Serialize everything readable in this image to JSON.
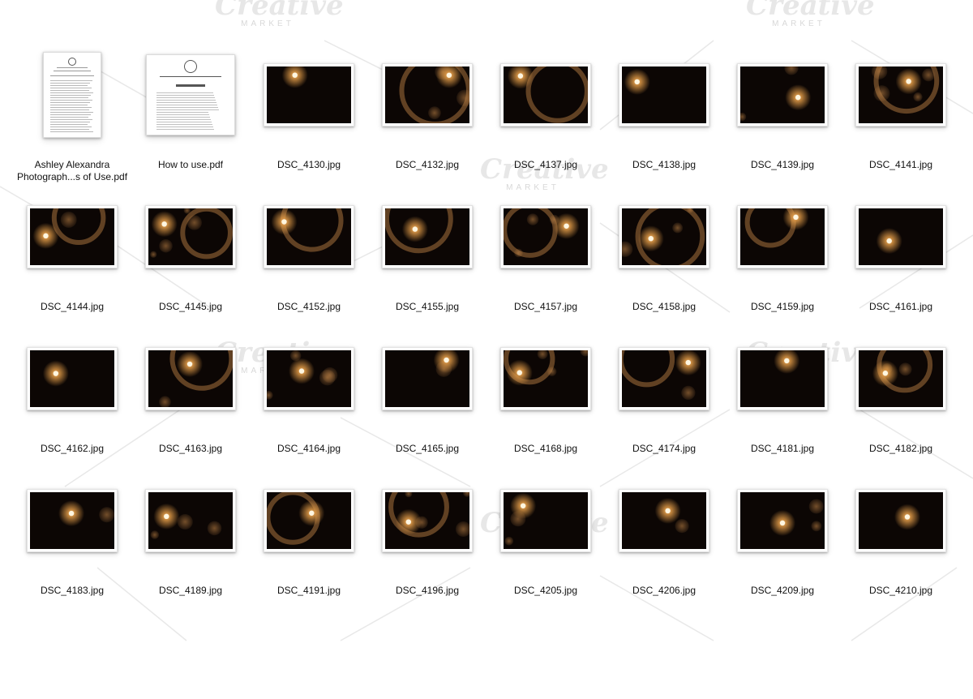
{
  "files": [
    {
      "name": "Ashley Alexandra Photograph...s of Use.pdf",
      "kind": "pdf-terms"
    },
    {
      "name": "How to use.pdf",
      "kind": "pdf-howto"
    },
    {
      "name": "DSC_4130.jpg",
      "kind": "photo"
    },
    {
      "name": "DSC_4132.jpg",
      "kind": "photo"
    },
    {
      "name": "DSC_4137.jpg",
      "kind": "photo"
    },
    {
      "name": "DSC_4138.jpg",
      "kind": "photo"
    },
    {
      "name": "DSC_4139.jpg",
      "kind": "photo"
    },
    {
      "name": "DSC_4141.jpg",
      "kind": "photo"
    },
    {
      "name": "DSC_4144.jpg",
      "kind": "photo"
    },
    {
      "name": "DSC_4145.jpg",
      "kind": "photo"
    },
    {
      "name": "DSC_4152.jpg",
      "kind": "photo"
    },
    {
      "name": "DSC_4155.jpg",
      "kind": "photo"
    },
    {
      "name": "DSC_4157.jpg",
      "kind": "photo"
    },
    {
      "name": "DSC_4158.jpg",
      "kind": "photo"
    },
    {
      "name": "DSC_4159.jpg",
      "kind": "photo"
    },
    {
      "name": "DSC_4161.jpg",
      "kind": "photo"
    },
    {
      "name": "DSC_4162.jpg",
      "kind": "photo"
    },
    {
      "name": "DSC_4163.jpg",
      "kind": "photo"
    },
    {
      "name": "DSC_4164.jpg",
      "kind": "photo"
    },
    {
      "name": "DSC_4165.jpg",
      "kind": "photo"
    },
    {
      "name": "DSC_4168.jpg",
      "kind": "photo"
    },
    {
      "name": "DSC_4174.jpg",
      "kind": "photo"
    },
    {
      "name": "DSC_4181.jpg",
      "kind": "photo"
    },
    {
      "name": "DSC_4182.jpg",
      "kind": "photo"
    },
    {
      "name": "DSC_4183.jpg",
      "kind": "photo"
    },
    {
      "name": "DSC_4189.jpg",
      "kind": "photo"
    },
    {
      "name": "DSC_4191.jpg",
      "kind": "photo"
    },
    {
      "name": "DSC_4196.jpg",
      "kind": "photo"
    },
    {
      "name": "DSC_4205.jpg",
      "kind": "photo"
    },
    {
      "name": "DSC_4206.jpg",
      "kind": "photo"
    },
    {
      "name": "DSC_4209.jpg",
      "kind": "photo"
    },
    {
      "name": "DSC_4210.jpg",
      "kind": "photo"
    }
  ],
  "watermark": {
    "title": "Creative",
    "subtitle": "MARKET"
  },
  "colors": {
    "photo_background": "#0c0604",
    "flare_core": "#fff6e0",
    "flare_warm": "#e8a04a",
    "bokeh": "#c98a4a"
  }
}
